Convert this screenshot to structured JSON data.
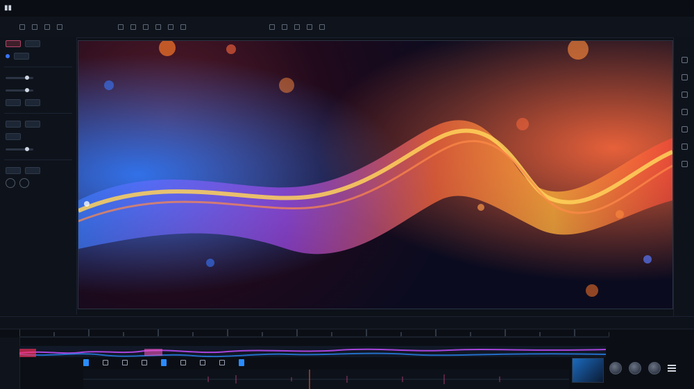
{
  "app": {
    "menu": [],
    "status_right": []
  },
  "toolbar": {
    "items": []
  },
  "left_panel": {
    "rows": []
  },
  "timeline": {
    "timecode": ""
  },
  "icons": {
    "logo": "logo-icon",
    "menu": "menu-icon",
    "play": "play-icon",
    "marker": "marker-icon",
    "knob": "knob-icon"
  },
  "colors": {
    "background": "#0d1118",
    "accent_blue": "#2a8cff",
    "accent_pink": "#b3456a",
    "viewer_orange": "#ff7a2a",
    "viewer_blue": "#2a6cff"
  }
}
